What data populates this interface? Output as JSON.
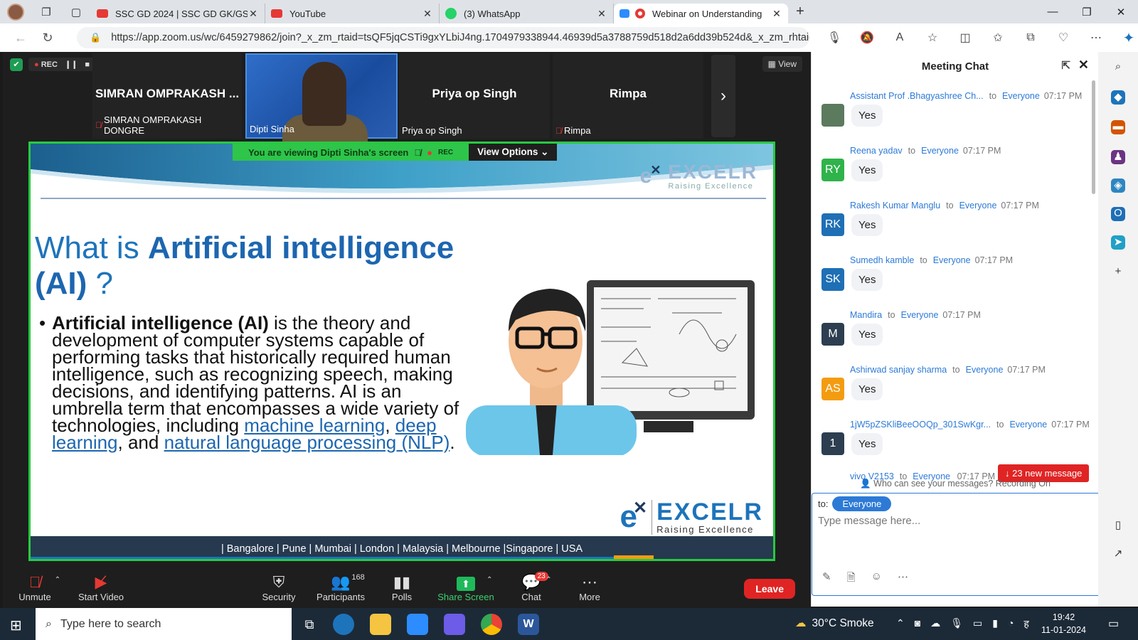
{
  "browser": {
    "tabs": [
      {
        "title": "SSC GD 2024 | SSC GD GK/GS Cl",
        "color": "#e53935"
      },
      {
        "title": "YouTube",
        "color": "#e53935"
      },
      {
        "title": "(3) WhatsApp",
        "color": "#25d366"
      },
      {
        "title": "Webinar on Understanding",
        "color": "#e53935"
      }
    ],
    "url": "https://app.zoom.us/wc/6459279862/join?_x_zm_rtaid=tsQF5jqCSTi9gxYLbiJ4ng.1704979338944.46939d5a3788759d518d2a6dd39b524d&_x_zm_rhtaid=..."
  },
  "zoom": {
    "rec_label": "REC",
    "view_label": "View",
    "participants": [
      {
        "name": "SIMRAN OMPRAKASH ...",
        "label": "SIMRAN OMPRAKASH DONGRE",
        "muted": true
      },
      {
        "name": "",
        "label": "Dipti Sinha",
        "muted": false
      },
      {
        "name": "Priya op Singh",
        "label": "Priya op Singh",
        "muted": false
      },
      {
        "name": "Rimpa",
        "label": "Rimpa",
        "muted": true
      }
    ],
    "banner": {
      "viewing": "You are viewing  Dipti Sinha's screen",
      "rec": "REC",
      "view_options": "View Options"
    },
    "slide": {
      "title_plain": "What is ",
      "title_bold": "Artificial intelligence (AI)",
      "title_end": " ?",
      "body_bold": "Artificial intelligence (AI)",
      "body_text": " is the theory and development of computer systems capable of performing tasks that historically required human intelligence, such as recognizing speech, making decisions, and identifying patterns. AI is an umbrella term that encompasses a wide variety of technologies, including ",
      "link1": "machine learning",
      "sep1": ", ",
      "link2": "deep learning",
      "sep2": ", and ",
      "link3": "natural language processing (NLP)",
      "end": ".",
      "logo_brand": "EXCELR",
      "logo_tag": "Raising Excellence",
      "footer": "| Bangalore  | Pune  | Mumbai | London  | Malaysia  | Melbourne  |Singapore  | USA"
    },
    "toolbar": {
      "unmute": "Unmute",
      "start_video": "Start Video",
      "security": "Security",
      "participants": "Participants",
      "participants_count": "168",
      "polls": "Polls",
      "share": "Share Screen",
      "chat": "Chat",
      "chat_count": "23",
      "more": "More",
      "leave": "Leave"
    }
  },
  "chat": {
    "title": "Meeting Chat",
    "messages": [
      {
        "sender": "Assistant Prof .Bhagyashree Ch...",
        "to": "to",
        "recipient": "Everyone",
        "time": "07:17 PM",
        "initials": "",
        "color": "#5b7a5e",
        "text": "Yes"
      },
      {
        "sender": "Reena yadav",
        "to": "to",
        "recipient": "Everyone",
        "time": "07:17 PM",
        "initials": "RY",
        "color": "#2fb34a",
        "text": "Yes"
      },
      {
        "sender": "Rakesh Kumar Manglu",
        "to": "to",
        "recipient": "Everyone",
        "time": "07:17 PM",
        "initials": "RK",
        "color": "#1f6fb5",
        "text": "Yes"
      },
      {
        "sender": "Sumedh kamble",
        "to": "to",
        "recipient": "Everyone",
        "time": "07:17 PM",
        "initials": "SK",
        "color": "#1f6fb5",
        "text": "Yes"
      },
      {
        "sender": "Mandira",
        "to": "to",
        "recipient": "Everyone",
        "time": "07:17 PM",
        "initials": "M",
        "color": "#2c3e50",
        "text": "Yes"
      },
      {
        "sender": "Ashirwad sanjay sharma",
        "to": "to",
        "recipient": "Everyone",
        "time": "07:17 PM",
        "initials": "AS",
        "color": "#f39c12",
        "text": "Yes"
      },
      {
        "sender": "1jW5pZSKliBeeOOQp_301SwKgr...",
        "to": "to",
        "recipient": "Everyone",
        "time": "07:17 PM",
        "initials": "1",
        "color": "#2c3e50",
        "text": "Yes"
      }
    ],
    "last_sender": "vivo V2153",
    "last_to": "to",
    "last_recipient": "Everyone",
    "last_time": "07:17 PM",
    "new_messages": "↓ 23 new message",
    "who_can_see": "Who can see your messages? Recording On",
    "compose_to": "to:",
    "compose_recipient": "Everyone",
    "placeholder": "Type message here..."
  },
  "taskbar": {
    "search": "Type here to search",
    "weather": "30°C  Smoke",
    "time": "19:42",
    "date": "11-01-2024"
  }
}
